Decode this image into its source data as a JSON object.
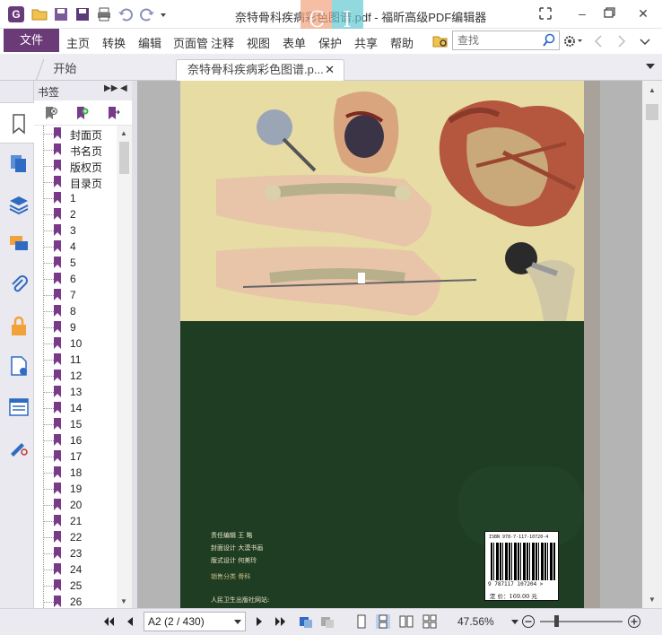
{
  "window": {
    "title": "奈特骨科疾病彩色图谱.pdf - 福昕高级PDF编辑器"
  },
  "menu": {
    "file": "文件",
    "items": [
      "主页",
      "转换",
      "编辑",
      "页面管",
      "注释",
      "视图",
      "表单",
      "保护",
      "共享",
      "帮助"
    ]
  },
  "search": {
    "placeholder": "查找"
  },
  "tabs": [
    {
      "label": "开始"
    },
    {
      "label": "奈特骨科疾病彩色图谱.p..."
    }
  ],
  "bookmarks": {
    "header": "书签",
    "items": [
      "封面页",
      "书名页",
      "版权页",
      "目录页",
      "1",
      "2",
      "3",
      "4",
      "5",
      "6",
      "7",
      "8",
      "9",
      "10",
      "11",
      "12",
      "13",
      "14",
      "15",
      "16",
      "17",
      "18",
      "19",
      "20",
      "21",
      "22",
      "23",
      "24",
      "25",
      "26"
    ]
  },
  "cover": {
    "credit_lines": [
      "责任编辑  王  略",
      "封面设计  大漠书画",
      "版式设计  何美玲"
    ],
    "category": "销售分类    骨科",
    "publisher": "人民卫生出版社网站:",
    "isbn_top": "ISBN 978-7-117-10720-4",
    "isbn_number": "9 787117 107204 >",
    "price": "定  价：169.00 元"
  },
  "status": {
    "page_display": "A2 (2 / 430)",
    "zoom": "47.56%"
  },
  "colors": {
    "brand": "#6b3b78",
    "cover_green": "#1f3d22",
    "cover_top": "#e6dca4"
  }
}
